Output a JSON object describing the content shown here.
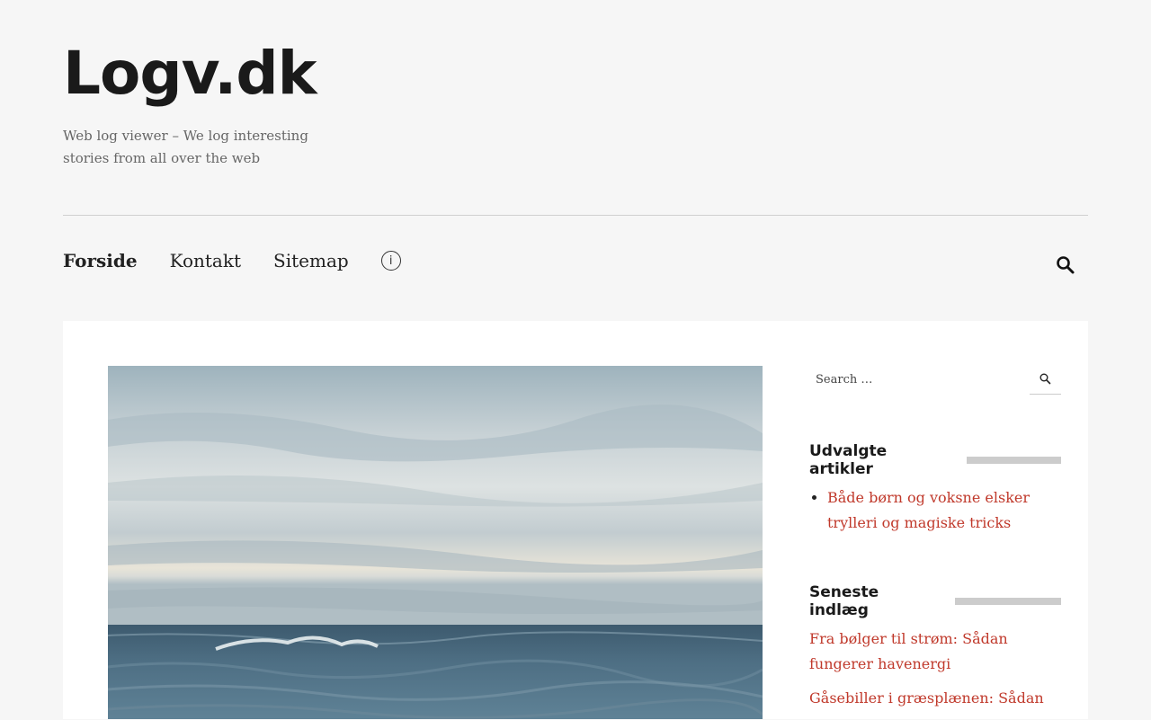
{
  "site": {
    "title": "Logv.dk",
    "tagline": "Web log viewer – We log interesting stories from all over the web"
  },
  "nav": {
    "items": [
      {
        "label": "Forside",
        "active": true
      },
      {
        "label": "Kontakt",
        "active": false
      },
      {
        "label": "Sitemap",
        "active": false
      }
    ],
    "info_icon": "ⓘ"
  },
  "sidebar": {
    "search_placeholder": "Search …",
    "featured": {
      "title": "Udvalgte artikler",
      "items": [
        "Både børn og voksne elsker trylleri og magiske tricks"
      ]
    },
    "recent": {
      "title": "Seneste indlæg",
      "items": [
        "Fra bølger til strøm: Sådan fungerer havenergi",
        "Gåsebiller i græsplænen: Sådan"
      ]
    }
  },
  "colors": {
    "background": "#f6f6f6",
    "link": "#c0392b",
    "title": "#1a1a1a"
  }
}
